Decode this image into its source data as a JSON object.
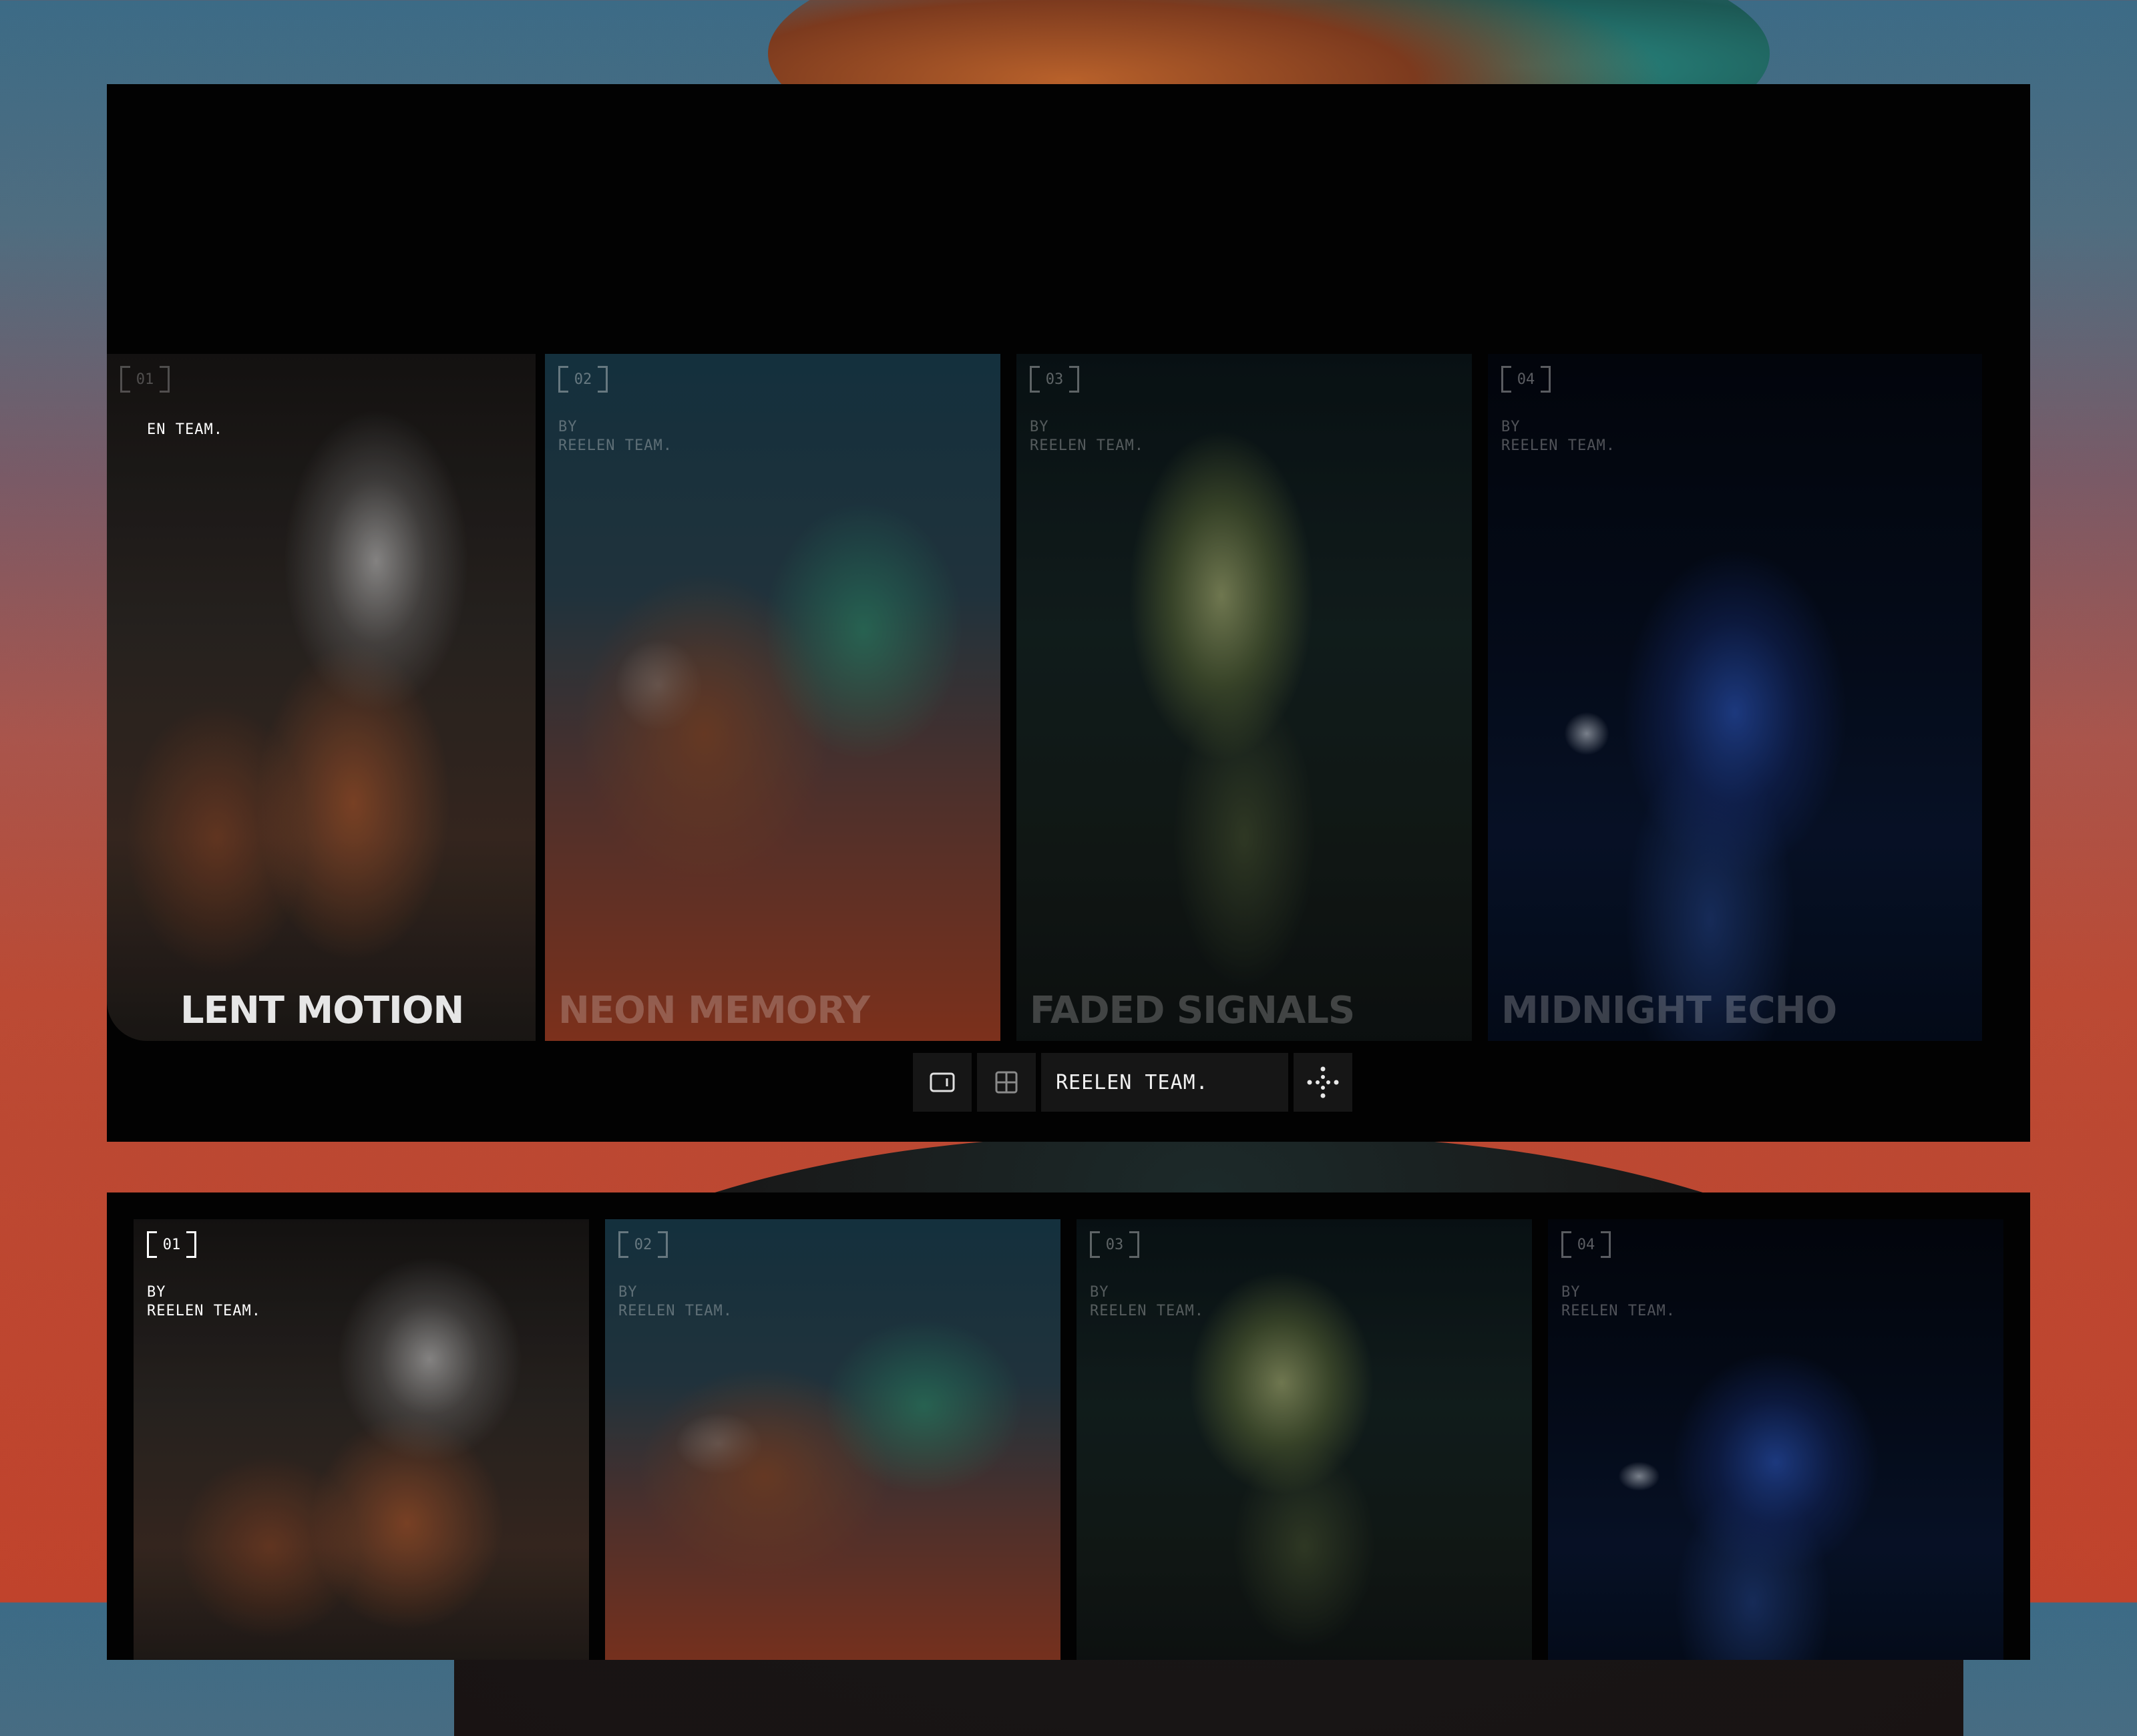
{
  "cards": [
    {
      "num": "01",
      "by": "BY",
      "team": "REELEN TEAM.",
      "title": "SILENT MOTION",
      "visible_title": "LENT MOTION",
      "visible_by": "EN TEAM."
    },
    {
      "num": "02",
      "by": "BY",
      "team": "REELEN TEAM.",
      "title": "NEON MEMORY"
    },
    {
      "num": "03",
      "by": "BY",
      "team": "REELEN TEAM.",
      "title": "FADED SIGNALS"
    },
    {
      "num": "04",
      "by": "BY",
      "team": "REELEN TEAM.",
      "title": "MIDNIGHT ECHO"
    }
  ],
  "toolbar": {
    "single_view_icon": "single-view-icon",
    "grid_view_icon": "grid-view-icon",
    "label": "REELEN TEAM.",
    "move_icon": "move-icon"
  },
  "colors": {
    "frame": "#020202",
    "toolbar_bg": "#161616",
    "active_title": "#e6e6e6"
  }
}
